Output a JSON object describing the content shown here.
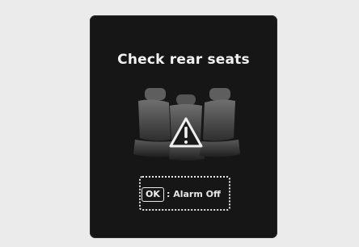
{
  "message": {
    "title": "Check rear seats",
    "ok_key_label": "OK",
    "alarm_action": ": Alarm Off"
  },
  "icons": {
    "rear_seats": "rear-seats-icon",
    "warning": "warning-triangle-icon"
  },
  "colors": {
    "background": "#ebebeb",
    "panel": "#161616",
    "text": "#f2f2f2"
  }
}
